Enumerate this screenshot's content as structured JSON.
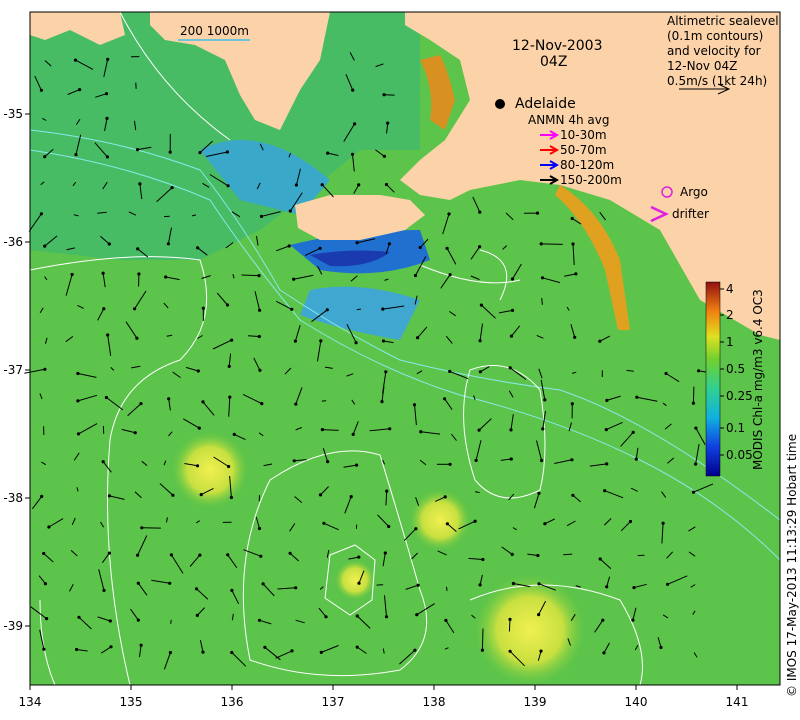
{
  "title": {
    "date": "12-Nov-2003",
    "time": "04Z"
  },
  "scale_label": "200  1000m",
  "altimetry_legend": {
    "lines": [
      "Altimetric sealevel",
      "(0.1m contours)",
      "and velocity for",
      "12-Nov 04Z",
      "0.5m/s (1kt 24h)"
    ]
  },
  "city": {
    "name": "Adelaide"
  },
  "anmn_legend": {
    "title": "ANMN 4h avg",
    "entries": [
      {
        "label": "10-30m",
        "color": "#ff00ff"
      },
      {
        "label": "50-70m",
        "color": "#ff0000"
      },
      {
        "label": "80-120m",
        "color": "#0000ff"
      },
      {
        "label": "150-200m",
        "color": "#000000"
      }
    ]
  },
  "markers": {
    "argo_label": "Argo",
    "argo_color": "#e020e0",
    "drifter_label": "drifter",
    "drifter_color": "#e020e0"
  },
  "colorbar": {
    "title": "MODIS Chl-a mg/m3 v6.4 OC3",
    "ticks": [
      "4",
      "2",
      "1",
      "0.5",
      "0.25",
      "0.1",
      "0.05"
    ]
  },
  "credit": "© IMOS 17-May-2013 11:13:29 Hobart time",
  "axes": {
    "x_ticks": [
      "134",
      "135",
      "136",
      "137",
      "138",
      "139",
      "140",
      "141"
    ],
    "y_ticks": [
      "-35",
      "-36",
      "-37",
      "-38",
      "-39"
    ]
  },
  "colors": {
    "land": "#fcd3a8",
    "ocean_green": "#58c248",
    "ocean_blue": "#2a7ad8",
    "contour": "#ffffff",
    "isobath": "#88e8e8"
  }
}
